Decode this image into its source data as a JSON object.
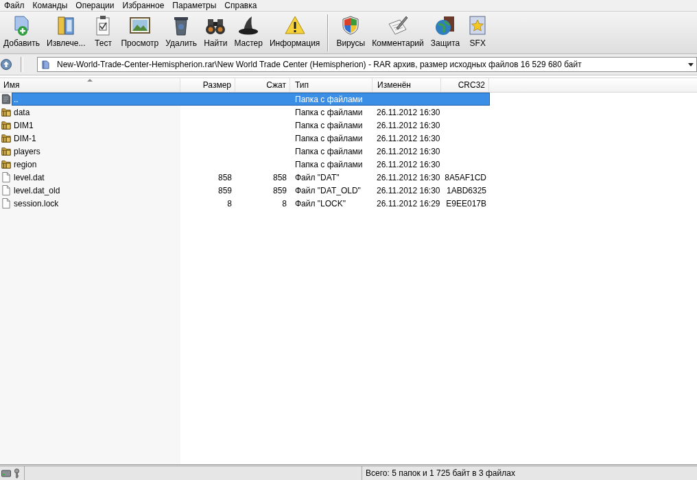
{
  "menu": [
    "Файл",
    "Команды",
    "Операции",
    "Избранное",
    "Параметры",
    "Справка"
  ],
  "toolbar": [
    [
      "Добавить",
      "Извлече...",
      "Тест",
      "Просмотр",
      "Удалить",
      "Найти",
      "Мастер",
      "Информация"
    ],
    [
      "Вирусы",
      "Комментарий",
      "Защита",
      "SFX"
    ]
  ],
  "address": {
    "value": "New-World-Trade-Center-Hemispherion.rar\\New World Trade Center (Hemispherion) - RAR архив, размер исходных файлов 16 529 680 байт"
  },
  "columns": [
    {
      "label": "Имя",
      "sorted": true
    },
    {
      "label": "Размер",
      "sorted": false
    },
    {
      "label": "Сжат",
      "sorted": false
    },
    {
      "label": "Тип",
      "sorted": false
    },
    {
      "label": "Изменён",
      "sorted": false
    },
    {
      "label": "CRC32",
      "sorted": false
    }
  ],
  "rows": [
    {
      "kind": "parent",
      "name": "..",
      "type": "Папка с файлами",
      "selected": true
    },
    {
      "kind": "folder",
      "name": "data",
      "type": "Папка с файлами",
      "modified": "26.11.2012 16:30",
      "selected": false
    },
    {
      "kind": "folder",
      "name": "DIM1",
      "type": "Папка с файлами",
      "modified": "26.11.2012 16:30",
      "selected": false
    },
    {
      "kind": "folder",
      "name": "DIM-1",
      "type": "Папка с файлами",
      "modified": "26.11.2012 16:30",
      "selected": false
    },
    {
      "kind": "folder",
      "name": "players",
      "type": "Папка с файлами",
      "modified": "26.11.2012 16:30",
      "selected": false
    },
    {
      "kind": "folder",
      "name": "region",
      "type": "Папка с файлами",
      "modified": "26.11.2012 16:30",
      "selected": false
    },
    {
      "kind": "file",
      "name": "level.dat",
      "size": "858",
      "packed": "858",
      "type": "Файл \"DAT\"",
      "modified": "26.11.2012 16:30",
      "crc": "8A5AF1CD",
      "selected": false
    },
    {
      "kind": "file",
      "name": "level.dat_old",
      "size": "859",
      "packed": "859",
      "type": "Файл \"DAT_OLD\"",
      "modified": "26.11.2012 16:30",
      "crc": "1ABD6325",
      "selected": false
    },
    {
      "kind": "file",
      "name": "session.lock",
      "size": "8",
      "packed": "8",
      "type": "Файл \"LOCK\"",
      "modified": "26.11.2012 16:29",
      "crc": "E9EE017B",
      "selected": false
    }
  ],
  "status_bar": {
    "text": "Всего: 5 папок и 1 725 байт в 3 файлах"
  }
}
